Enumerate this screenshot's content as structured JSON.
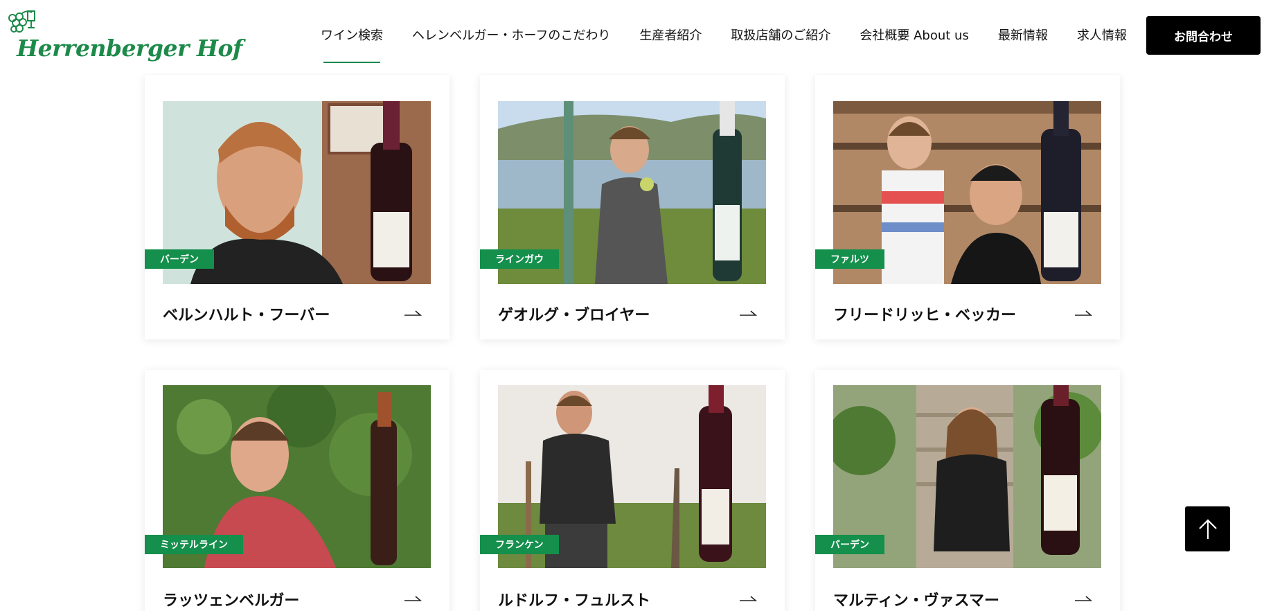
{
  "header": {
    "logo_text": "Herrenberger Hof",
    "nav": [
      {
        "label": "ワイン検索",
        "active": true
      },
      {
        "label": "ヘレンベルガー・ホーフのこだわり",
        "active": false
      },
      {
        "label": "生産者紹介",
        "active": false
      },
      {
        "label": "取扱店舗のご紹介",
        "active": false
      },
      {
        "label": "会社概要 About us",
        "active": false
      },
      {
        "label": "最新情報",
        "active": false
      },
      {
        "label": "求人情報",
        "active": false
      }
    ],
    "contact_label": "お問合わせ"
  },
  "producers": [
    {
      "region": "バーデン",
      "name": "ベルンハルト・フーバー",
      "arrow_icon": "arrow-right-icon"
    },
    {
      "region": "ラインガウ",
      "name": "ゲオルグ・ブロイヤー",
      "arrow_icon": "arrow-right-icon"
    },
    {
      "region": "ファルツ",
      "name": "フリードリッヒ・ベッカー",
      "arrow_icon": "arrow-right-icon"
    },
    {
      "region": "ミッテルライン",
      "name": "ラッツェンベルガー",
      "arrow_icon": "arrow-right-icon"
    },
    {
      "region": "フランケン",
      "name": "ルドルフ・フュルスト",
      "arrow_icon": "arrow-right-icon"
    },
    {
      "region": "バーデン",
      "name": "マルティン・ヴァスマー",
      "arrow_icon": "arrow-right-icon"
    }
  ],
  "scroll_top_icon": "arrow-up-icon",
  "colors": {
    "accent_green": "#148f4c",
    "logo_green": "#1d8a4a",
    "button_black": "#000000"
  }
}
